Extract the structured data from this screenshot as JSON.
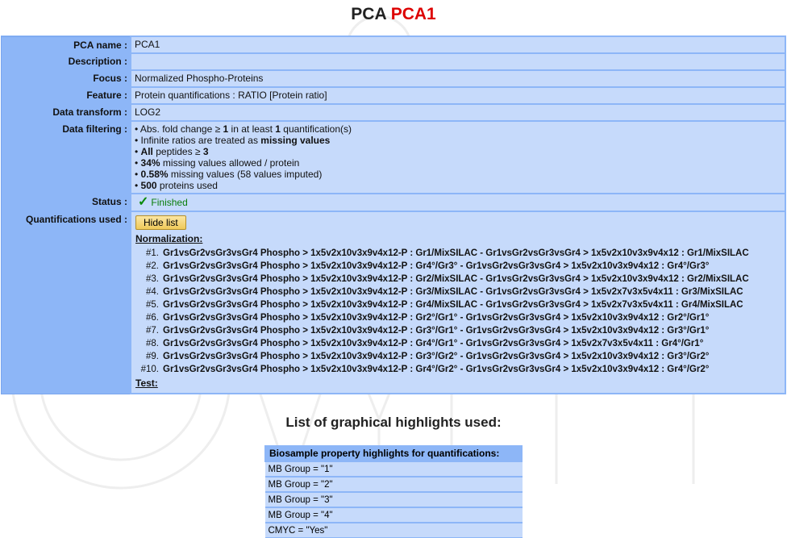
{
  "header": {
    "prefix": "PCA",
    "name": "PCA1"
  },
  "labels": {
    "pca_name": "PCA name :",
    "description": "Description :",
    "focus": "Focus :",
    "feature": "Feature :",
    "data_transform": "Data transform :",
    "data_filtering": "Data filtering :",
    "status": "Status :",
    "quantifications": "Quantifications used :"
  },
  "values": {
    "pca_name": "PCA1",
    "description": "",
    "focus": "Normalized Phospho-Proteins",
    "feature": "Protein quantifications : RATIO [Protein ratio]",
    "data_transform": "LOG2",
    "status": "Finished"
  },
  "filtering": {
    "l1_a": "Abs. fold change ≥ ",
    "l1_b": "1",
    "l1_c": " in at least ",
    "l1_d": "1",
    "l1_e": " quantification(s)",
    "l2_a": "Infinite ratios are treated as ",
    "l2_b": "missing values",
    "l3_a": "All",
    "l3_b": " peptides ≥ ",
    "l3_c": "3",
    "l4_a": "34%",
    "l4_b": " missing values allowed / protein",
    "l5_a": "0.58%",
    "l5_b": " missing values (58 values imputed)",
    "l6_a": "500",
    "l6_b": " proteins used"
  },
  "quant": {
    "hide_label": "Hide list",
    "normalization_label": "Normalization:",
    "test_label": "Test:",
    "items": [
      {
        "num": "#1.",
        "text": "Gr1vsGr2vsGr3vsGr4 Phospho > 1x5v2x10v3x9v4x12-P : Gr1/MixSILAC - Gr1vsGr2vsGr3vsGr4 > 1x5v2x10v3x9v4x12 : Gr1/MixSILAC"
      },
      {
        "num": "#2.",
        "text": "Gr1vsGr2vsGr3vsGr4 Phospho > 1x5v2x10v3x9v4x12-P : Gr4°/Gr3° - Gr1vsGr2vsGr3vsGr4 > 1x5v2x10v3x9v4x12 : Gr4°/Gr3°"
      },
      {
        "num": "#3.",
        "text": "Gr1vsGr2vsGr3vsGr4 Phospho > 1x5v2x10v3x9v4x12-P : Gr2/MixSILAC - Gr1vsGr2vsGr3vsGr4 > 1x5v2x10v3x9v4x12 : Gr2/MixSILAC"
      },
      {
        "num": "#4.",
        "text": "Gr1vsGr2vsGr3vsGr4 Phospho > 1x5v2x10v3x9v4x12-P : Gr3/MixSILAC - Gr1vsGr2vsGr3vsGr4 > 1x5v2x7v3x5v4x11 : Gr3/MixSILAC"
      },
      {
        "num": "#5.",
        "text": "Gr1vsGr2vsGr3vsGr4 Phospho > 1x5v2x10v3x9v4x12-P : Gr4/MixSILAC - Gr1vsGr2vsGr3vsGr4 > 1x5v2x7v3x5v4x11 : Gr4/MixSILAC"
      },
      {
        "num": "#6.",
        "text": "Gr1vsGr2vsGr3vsGr4 Phospho > 1x5v2x10v3x9v4x12-P : Gr2°/Gr1° - Gr1vsGr2vsGr3vsGr4 > 1x5v2x10v3x9v4x12 : Gr2°/Gr1°"
      },
      {
        "num": "#7.",
        "text": "Gr1vsGr2vsGr3vsGr4 Phospho > 1x5v2x10v3x9v4x12-P : Gr3°/Gr1° - Gr1vsGr2vsGr3vsGr4 > 1x5v2x10v3x9v4x12 : Gr3°/Gr1°"
      },
      {
        "num": "#8.",
        "text": "Gr1vsGr2vsGr3vsGr4 Phospho > 1x5v2x10v3x9v4x12-P : Gr4°/Gr1° - Gr1vsGr2vsGr3vsGr4 > 1x5v2x7v3x5v4x11 : Gr4°/Gr1°"
      },
      {
        "num": "#9.",
        "text": "Gr1vsGr2vsGr3vsGr4 Phospho > 1x5v2x10v3x9v4x12-P : Gr3°/Gr2° - Gr1vsGr2vsGr3vsGr4 > 1x5v2x10v3x9v4x12 : Gr3°/Gr2°"
      },
      {
        "num": "#10.",
        "text": "Gr1vsGr2vsGr3vsGr4 Phospho > 1x5v2x10v3x9v4x12-P : Gr4°/Gr2° - Gr1vsGr2vsGr3vsGr4 > 1x5v2x10v3x9v4x12 : Gr4°/Gr2°"
      }
    ]
  },
  "highlights": {
    "title": "List of graphical highlights used:",
    "header": "Biosample property highlights for quantifications:",
    "rows": [
      "MB Group = \"1\"",
      "MB Group = \"2\"",
      "MB Group = \"3\"",
      "MB Group = \"4\"",
      "CMYC = \"Yes\""
    ]
  },
  "colors": {
    "label_bg": "#8db6f7",
    "value_bg": "#c6dafb",
    "accent_red": "#dd0000",
    "status_green": "#0a7d0a"
  }
}
